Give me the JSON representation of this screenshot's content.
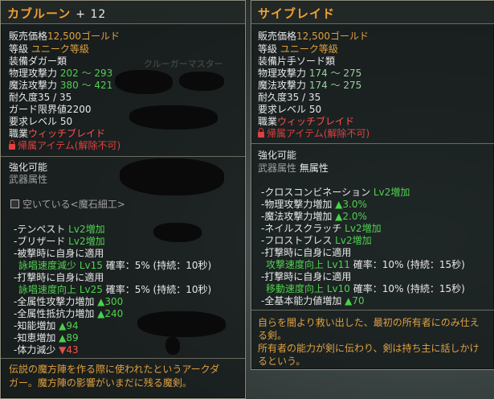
{
  "left": {
    "title": "カブルーン",
    "enhance": "+ 12",
    "rows": [
      {
        "label": "販売価格",
        "value": "12,500ゴールド"
      },
      {
        "label": "等級",
        "value": "ユニーク等級"
      },
      {
        "label": "装備",
        "value": "ダガー類"
      },
      {
        "label": "物理攻撃力",
        "value": "202 ～ 293"
      },
      {
        "label": "魔法攻撃力",
        "value": "380 ～ 421"
      },
      {
        "label": "耐久度",
        "value": "35 / 35"
      },
      {
        "label": "ガード限界値",
        "value": "2200"
      },
      {
        "label": "要求レベル",
        "value": "50"
      },
      {
        "label": "職業",
        "value": "ウィッチブレイド"
      }
    ],
    "bound": "帰属アイテム(解除不可)",
    "faded_text": "クルーガーマスター",
    "enh_title": "強化可能",
    "attr_label": "武器属性",
    "socket": "空いている<魔石細工>",
    "opts": [
      {
        "pre": "-テンペスト ",
        "val": "Lv2増加"
      },
      {
        "pre": "-ブリザード ",
        "val": "Lv2増加"
      },
      {
        "pre": "-被撃時に自身に適用",
        "val": ""
      },
      {
        "pre": "",
        "name": "詠唱速度減少 Lv15",
        "rest": " 確率：5% (持続：10秒)"
      },
      {
        "pre": "-打撃時に自身に適用",
        "val": ""
      },
      {
        "pre": "",
        "name": "詠唱速度向上 Lv25",
        "rest": " 確率：5% (持続：10秒)"
      },
      {
        "pre": "-全属性攻撃力増加 ",
        "arrow": "▲",
        "num": "300"
      },
      {
        "pre": "-全属性抵抗力増加 ",
        "arrow": "▲",
        "num": "240"
      },
      {
        "pre": "-知能増加 ",
        "arrow": "▲",
        "num": "94"
      },
      {
        "pre": "-知恵増加 ",
        "arrow": "▲",
        "num": "89"
      },
      {
        "pre": "-体力減少 ",
        "arrow": "▼",
        "num": "43"
      }
    ],
    "desc": [
      "伝説の魔方陣を作る際に使われたというアークダ",
      "ガー。魔方陣の影響がいまだに残る魔剣。"
    ]
  },
  "right": {
    "title": "サイブレイド",
    "rows": [
      {
        "label": "販売価格",
        "value": "12,500ゴールド"
      },
      {
        "label": "等級",
        "value": "ユニーク等級"
      },
      {
        "label": "装備",
        "value": "片手ソード類"
      },
      {
        "label": "物理攻撃力",
        "value": "174 ～ 275"
      },
      {
        "label": "魔法攻撃力",
        "value": "174 ～ 275"
      },
      {
        "label": "耐久度",
        "value": "35 / 35"
      },
      {
        "label": "要求レベル",
        "value": "50"
      },
      {
        "label": "職業",
        "value": "ウィッチブレイド"
      }
    ],
    "bound": "帰属アイテム(解除不可)",
    "enh_title": "強化可能",
    "attr_label": "武器属性",
    "attr_value": "無属性",
    "opts": [
      {
        "pre": "-クロスコンビネーション ",
        "val": "Lv2増加"
      },
      {
        "pre": "-物理攻撃力増加 ",
        "arrow": "▲",
        "num": "3.0%"
      },
      {
        "pre": "-魔法攻撃力増加 ",
        "arrow": "▲",
        "num": "2.0%"
      },
      {
        "pre": "-ネイルスクラッチ ",
        "val": "Lv2増加"
      },
      {
        "pre": "-フロストブレス ",
        "val": "Lv2増加"
      },
      {
        "pre": "-打撃時に自身に適用",
        "val": ""
      },
      {
        "pre": "",
        "name": "攻撃速度向上 Lv11",
        "rest": " 確率：10% (持続：15秒)"
      },
      {
        "pre": "-打撃時に自身に適用",
        "val": ""
      },
      {
        "pre": "",
        "name": "移動速度向上 Lv10",
        "rest": " 確率：10% (持続：15秒)"
      },
      {
        "pre": "-全基本能力値増加 ",
        "arrow": "▲",
        "num": "70"
      }
    ],
    "desc": [
      "自らを闇より救い出した、最初の所有者にのみ仕え",
      "る剣。",
      "所有者の能力が剣に伝わり、剣は持ち主に話しかけ",
      "るという。"
    ]
  }
}
